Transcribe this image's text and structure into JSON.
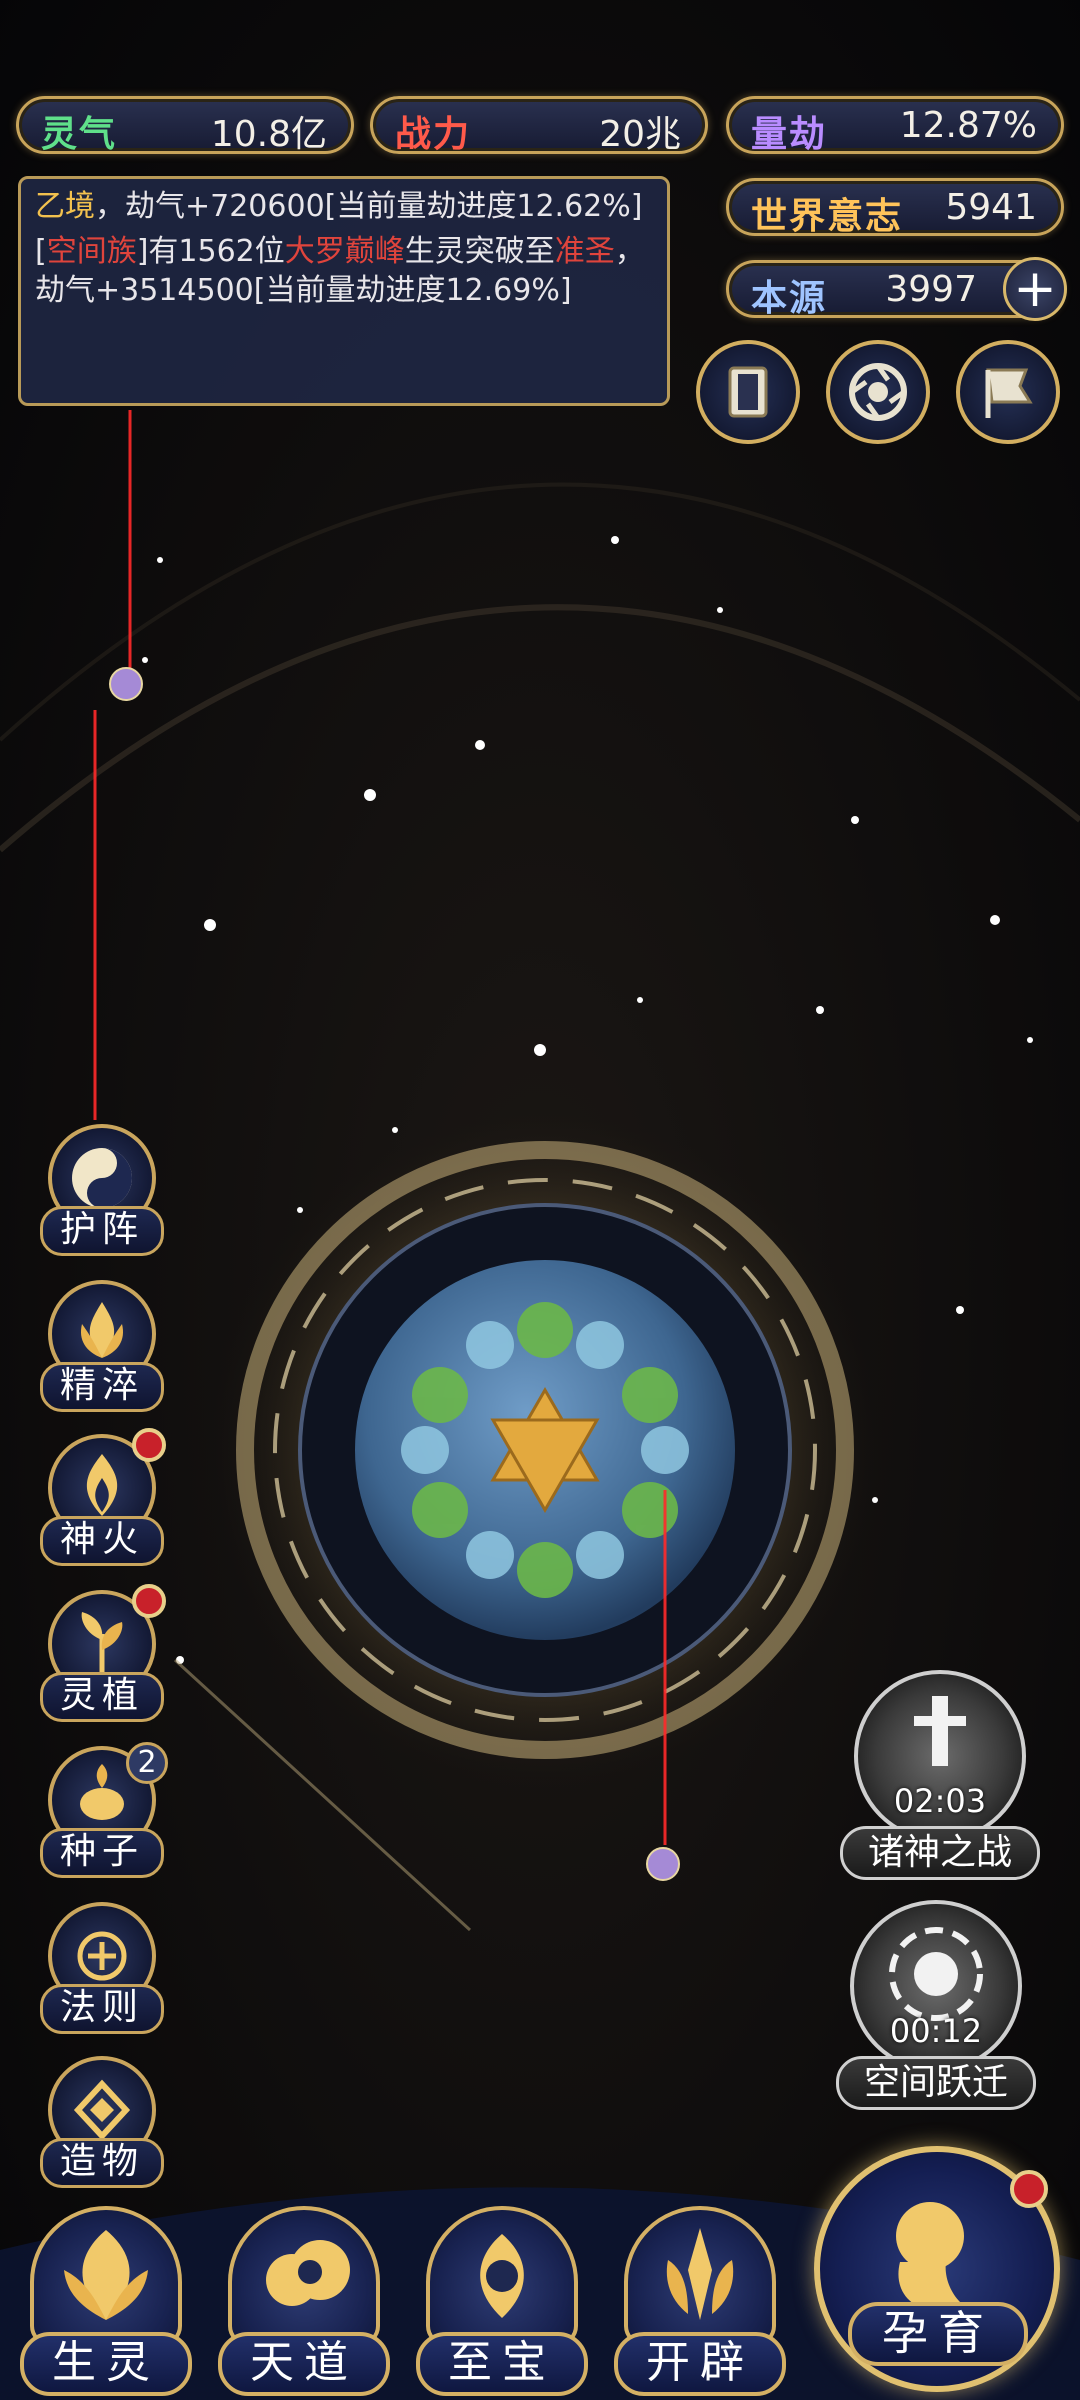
{
  "resources": {
    "lingqi": {
      "label": "灵气",
      "value": "10.8亿",
      "color": "#5fe08a"
    },
    "zhanli": {
      "label": "战力",
      "value": "20兆",
      "color": "#ff5a4a"
    },
    "liangjie": {
      "label": "量劫",
      "value": "12.87%",
      "color": "#b98cff"
    },
    "shijie": {
      "label": "世界意志",
      "value": "5941",
      "color": "#ffc35a"
    },
    "benyuan": {
      "label": "本源",
      "value": "3997",
      "color": "#9fc4ff",
      "add_symbol": "+"
    }
  },
  "log": {
    "line1_a": "乙境",
    "line1_b": "，劫气+720600[当前量劫进度12.62%]",
    "line2_a": "[",
    "line2_b": "空间族",
    "line2_c": "]有1562位",
    "line2_d": "大罗巅峰",
    "line2_e": "生灵突破至",
    "line2_f": "准圣",
    "line2_g": "，劫气+3514500[当前量劫进度12.69%]"
  },
  "toolbar": {
    "icons": [
      "scroll-icon",
      "vortex-icon",
      "flag-icon"
    ]
  },
  "side_menu": [
    {
      "label": "护阵",
      "icon": "yin-yang-icon",
      "red_dot": false
    },
    {
      "label": "精淬",
      "icon": "lotus-flame-icon",
      "red_dot": false
    },
    {
      "label": "神火",
      "icon": "fire-icon",
      "red_dot": true
    },
    {
      "label": "灵植",
      "icon": "plant-icon",
      "red_dot": true
    },
    {
      "label": "种子",
      "icon": "seed-icon",
      "red_dot": false,
      "badge": "2"
    },
    {
      "label": "法则",
      "icon": "rune-icon",
      "red_dot": false
    },
    {
      "label": "造物",
      "icon": "diamond-icon",
      "red_dot": false
    }
  ],
  "events": [
    {
      "name": "诸神之战",
      "timer": "02:03",
      "icon": "sword-icon"
    },
    {
      "name": "空间跃迁",
      "timer": "00:12",
      "icon": "portal-icon"
    }
  ],
  "bottom_nav": [
    {
      "label": "生灵",
      "icon": "phoenix-icon"
    },
    {
      "label": "天道",
      "icon": "cloud-icon"
    },
    {
      "label": "至宝",
      "icon": "treasure-icon"
    },
    {
      "label": "开辟",
      "icon": "axe-icon"
    }
  ],
  "main_button": {
    "label": "孕育",
    "icon": "embryo-icon",
    "red_dot": true
  }
}
